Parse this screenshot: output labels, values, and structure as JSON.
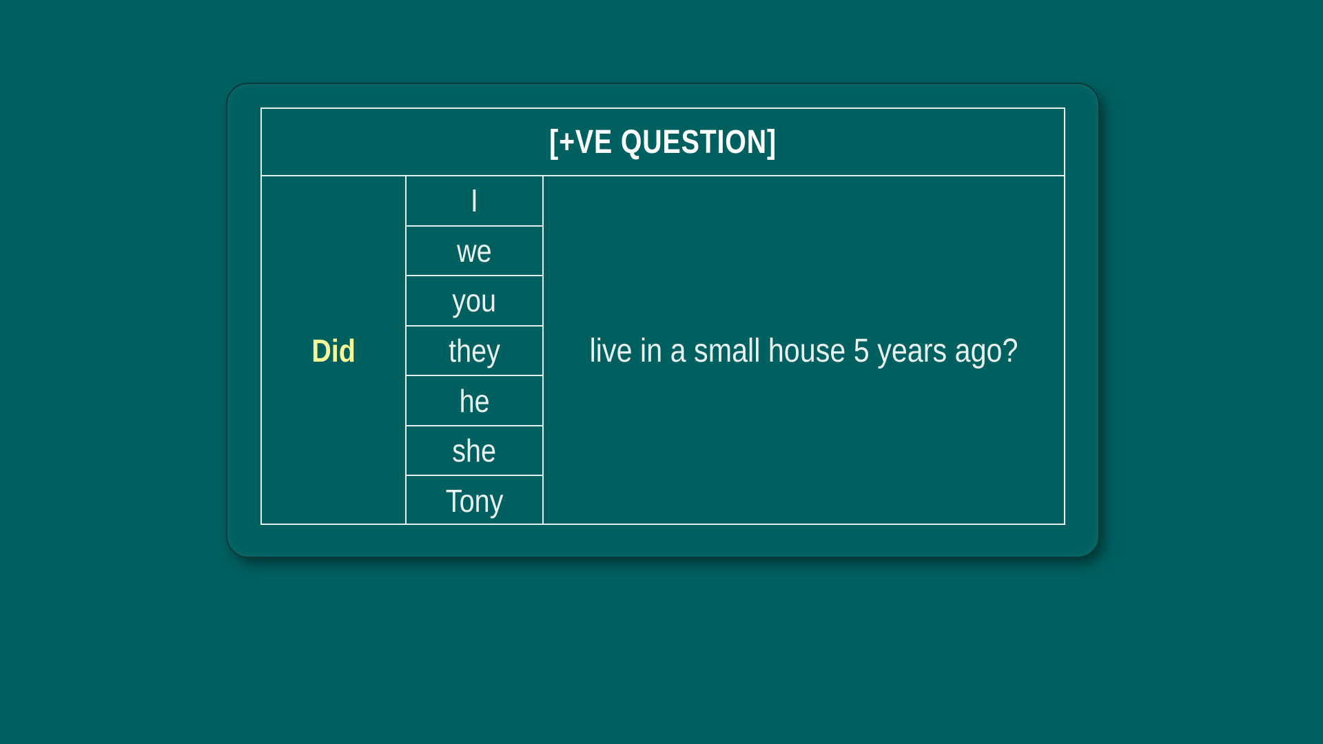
{
  "table": {
    "title": "[+VE QUESTION]",
    "auxiliary": "Did",
    "subjects": [
      "I",
      "we",
      "you",
      "they",
      "he",
      "she",
      "Tony"
    ],
    "predicate": "live in a small house 5 years ago?"
  },
  "colors": {
    "background": "#005f5f",
    "card": "#006060",
    "border": "#e6f0ef",
    "auxiliary_text": "#f5f59a",
    "text": "#e8f1f0"
  }
}
